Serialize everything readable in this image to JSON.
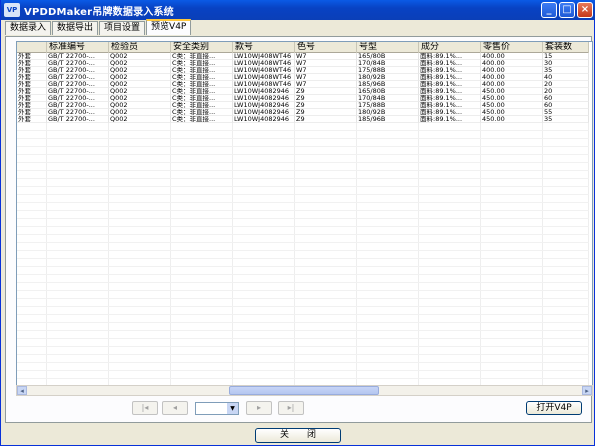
{
  "window": {
    "title": "VPDDMaker吊牌数据录入系统",
    "icon_text": "VP"
  },
  "title_buttons": {
    "minimize": "_",
    "maximize": "□",
    "close": "×"
  },
  "tabs": [
    {
      "label": "数据录入",
      "active": false
    },
    {
      "label": "数据导出",
      "active": false
    },
    {
      "label": "项目设置",
      "active": false
    },
    {
      "label": "预览V4P",
      "active": true
    }
  ],
  "table": {
    "columns": [
      "",
      "标准编号",
      "检验员",
      "安全类别",
      "款号",
      "色号",
      "号型",
      "成分",
      "零售价",
      "套装数"
    ],
    "rows": [
      [
        "外套",
        "GB/T 22700-...",
        "Q002",
        "C类：非直接...",
        "LW10WJ408WT46",
        "W7",
        "165/80B",
        "面料:89.1%...",
        "400.00",
        "15"
      ],
      [
        "外套",
        "GB/T 22700-...",
        "Q002",
        "C类：非直接...",
        "LW10WJ408WT46",
        "W7",
        "170/84B",
        "面料:89.1%...",
        "400.00",
        "30"
      ],
      [
        "外套",
        "GB/T 22700-...",
        "Q002",
        "C类：非直接...",
        "LW10WJ408WT46",
        "W7",
        "175/88B",
        "面料:89.1%...",
        "400.00",
        "35"
      ],
      [
        "外套",
        "GB/T 22700-...",
        "Q002",
        "C类：非直接...",
        "LW10WJ408WT46",
        "W7",
        "180/92B",
        "面料:89.1%...",
        "400.00",
        "40"
      ],
      [
        "外套",
        "GB/T 22700-...",
        "Q002",
        "C类：非直接...",
        "LW10WJ408WT46",
        "W7",
        "185/96B",
        "面料:89.1%...",
        "400.00",
        "20"
      ],
      [
        "外套",
        "GB/T 22700-...",
        "Q002",
        "C类：非直接...",
        "LW10WJ4082946",
        "Z9",
        "165/80B",
        "面料:89.1%...",
        "450.00",
        "20"
      ],
      [
        "外套",
        "GB/T 22700-...",
        "Q002",
        "C类：非直接...",
        "LW10WJ4082946",
        "Z9",
        "170/84B",
        "面料:89.1%...",
        "450.00",
        "60"
      ],
      [
        "外套",
        "GB/T 22700-...",
        "Q002",
        "C类：非直接...",
        "LW10WJ4082946",
        "Z9",
        "175/88B",
        "面料:89.1%...",
        "450.00",
        "60"
      ],
      [
        "外套",
        "GB/T 22700-...",
        "Q002",
        "C类：非直接...",
        "LW10WJ4082946",
        "Z9",
        "180/92B",
        "面料:89.1%...",
        "450.00",
        "55"
      ],
      [
        "外套",
        "GB/T 22700-...",
        "Q002",
        "C类：非直接...",
        "LW10WJ4082946",
        "Z9",
        "185/96B",
        "面料:89.1%...",
        "450.00",
        "35"
      ]
    ]
  },
  "scrollbar": {
    "left_arrow": "◂",
    "right_arrow": "▸"
  },
  "navigation": {
    "first": "|◂",
    "prev": "◂",
    "page_value": "",
    "dropdown_arrow": "▼",
    "next": "▸",
    "last": "▸|"
  },
  "buttons": {
    "open": "打开V4P",
    "close": "关　　闭"
  }
}
